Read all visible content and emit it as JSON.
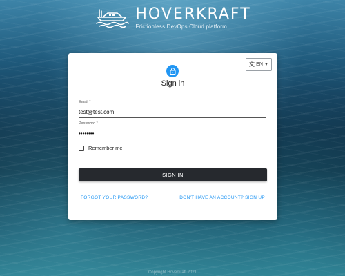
{
  "brand": {
    "name": "HOVERKRAFT",
    "tagline": "Frictionless DevOps Cloud platform",
    "logo_icon": "hovercraft-logo-icon"
  },
  "language": {
    "icon": "translate-icon",
    "selected": "EN"
  },
  "login": {
    "lock_icon": "lock-icon",
    "title": "Sign in",
    "email_label": "Email *",
    "email_value": "test@test.com",
    "password_label": "Password *",
    "password_value": "••••••••",
    "remember_label": "Remember me",
    "signin_label": "SIGN IN",
    "forgot_label": "FORGOT YOUR PASSWORD?",
    "signup_label": "DON'T HAVE AN ACCOUNT? SIGN UP"
  },
  "footer": {
    "text": "Copyright Hoverkraft 2021"
  },
  "colors": {
    "primary": "#2196f3",
    "button": "#26292e"
  }
}
